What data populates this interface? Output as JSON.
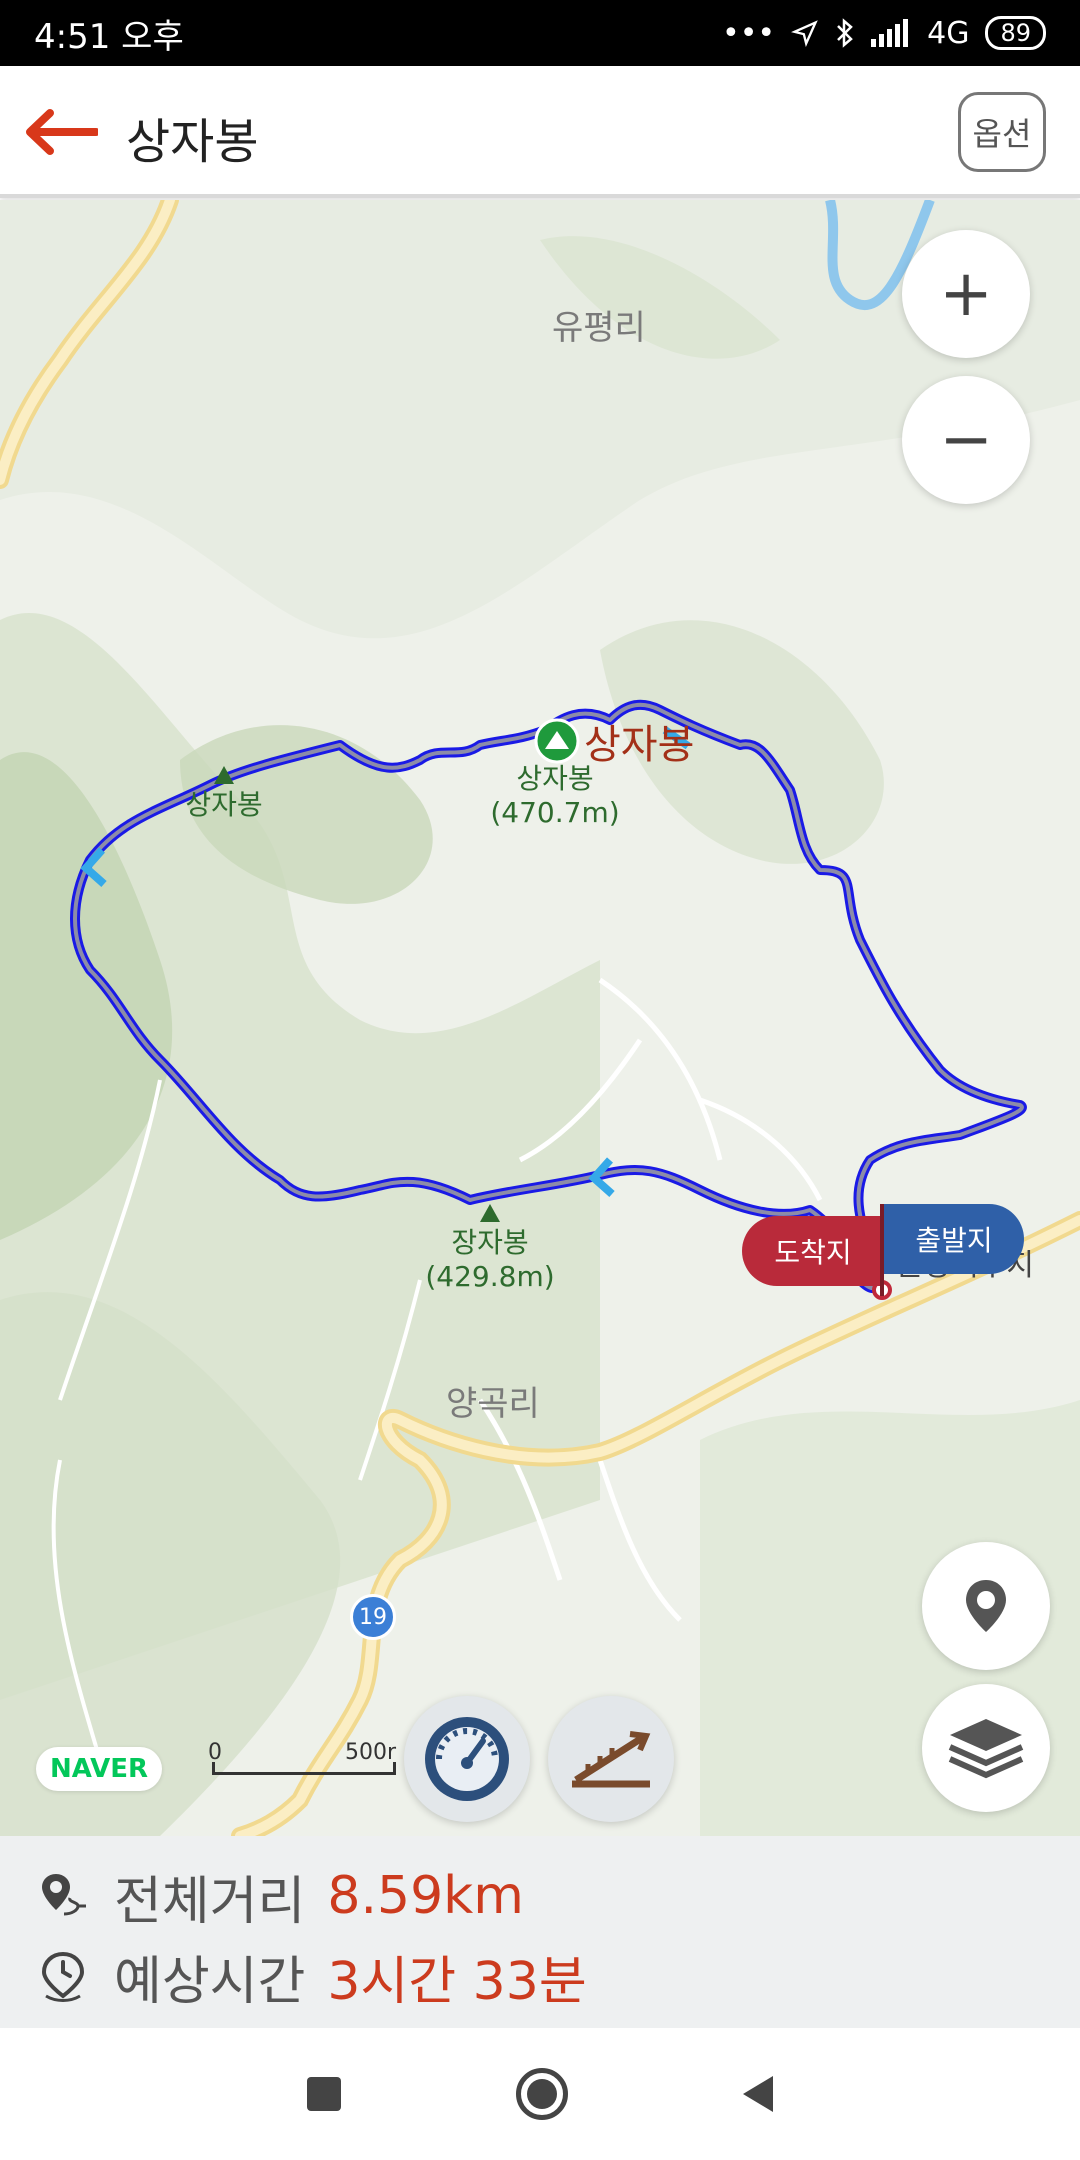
{
  "status_bar": {
    "time": "4:51 오후",
    "network": "4G",
    "battery": "89"
  },
  "header": {
    "title": "상자봉",
    "options_label": "옵션"
  },
  "map": {
    "place_labels": {
      "yupyeong": "유평리",
      "yanggok": "양곡리",
      "reservoir": "문광저수지"
    },
    "summit_marker_label": "상자봉",
    "peaks": [
      {
        "name": "상자봉",
        "elevation": "(470.7m)"
      },
      {
        "name": "상자봉",
        "elevation": ""
      },
      {
        "name": "장자봉",
        "elevation": "(429.8m)"
      }
    ],
    "flags": {
      "arrival": "도착지",
      "departure": "출발지"
    },
    "road_number": "19",
    "brand": "NAVER",
    "scale": {
      "start": "0",
      "end": "500r"
    }
  },
  "controls": {
    "zoom_in": "+",
    "zoom_out": "−"
  },
  "summary": {
    "distance_label": "전체거리",
    "distance_value": "8.59km",
    "time_label": "예상시간",
    "time_value": "3시간 33분"
  },
  "colors": {
    "accent": "#cc3b1e",
    "route": "#1a1ae6",
    "peak_green": "#2e6b2e"
  }
}
